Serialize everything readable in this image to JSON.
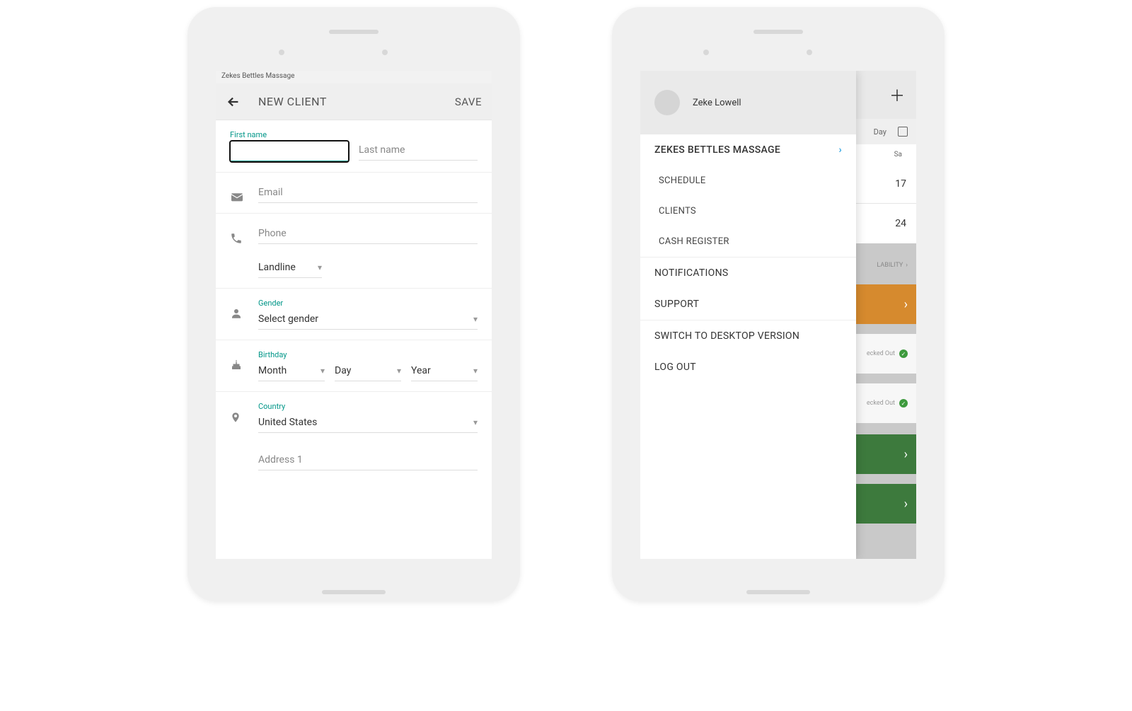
{
  "left": {
    "statusbar": "Zekes Bettles Massage",
    "header": {
      "title": "NEW CLIENT",
      "save": "SAVE"
    },
    "name": {
      "first_label": "First name",
      "last_placeholder": "Last name"
    },
    "email_placeholder": "Email",
    "phone_placeholder": "Phone",
    "phone_type": "Landline",
    "gender": {
      "label": "Gender",
      "value": "Select gender"
    },
    "birthday": {
      "label": "Birthday",
      "month": "Month",
      "day": "Day",
      "year": "Year"
    },
    "country": {
      "label": "Country",
      "value": "United States"
    },
    "address_placeholder": "Address 1"
  },
  "right": {
    "user": "Zeke Lowell",
    "business": "ZEKES BETTLES MASSAGE",
    "menu": {
      "schedule": "SCHEDULE",
      "clients": "CLIENTS",
      "cash": "CASH REGISTER",
      "notifications": "NOTIFICATIONS",
      "support": "SUPPORT",
      "desktop": "SWITCH TO DESKTOP VERSION",
      "logout": "LOG OUT"
    },
    "bg": {
      "tab": "Day",
      "dayhead": "Sa",
      "date1": "17",
      "date2": "24",
      "availability": "LABILITY",
      "status": "ecked Out"
    }
  }
}
